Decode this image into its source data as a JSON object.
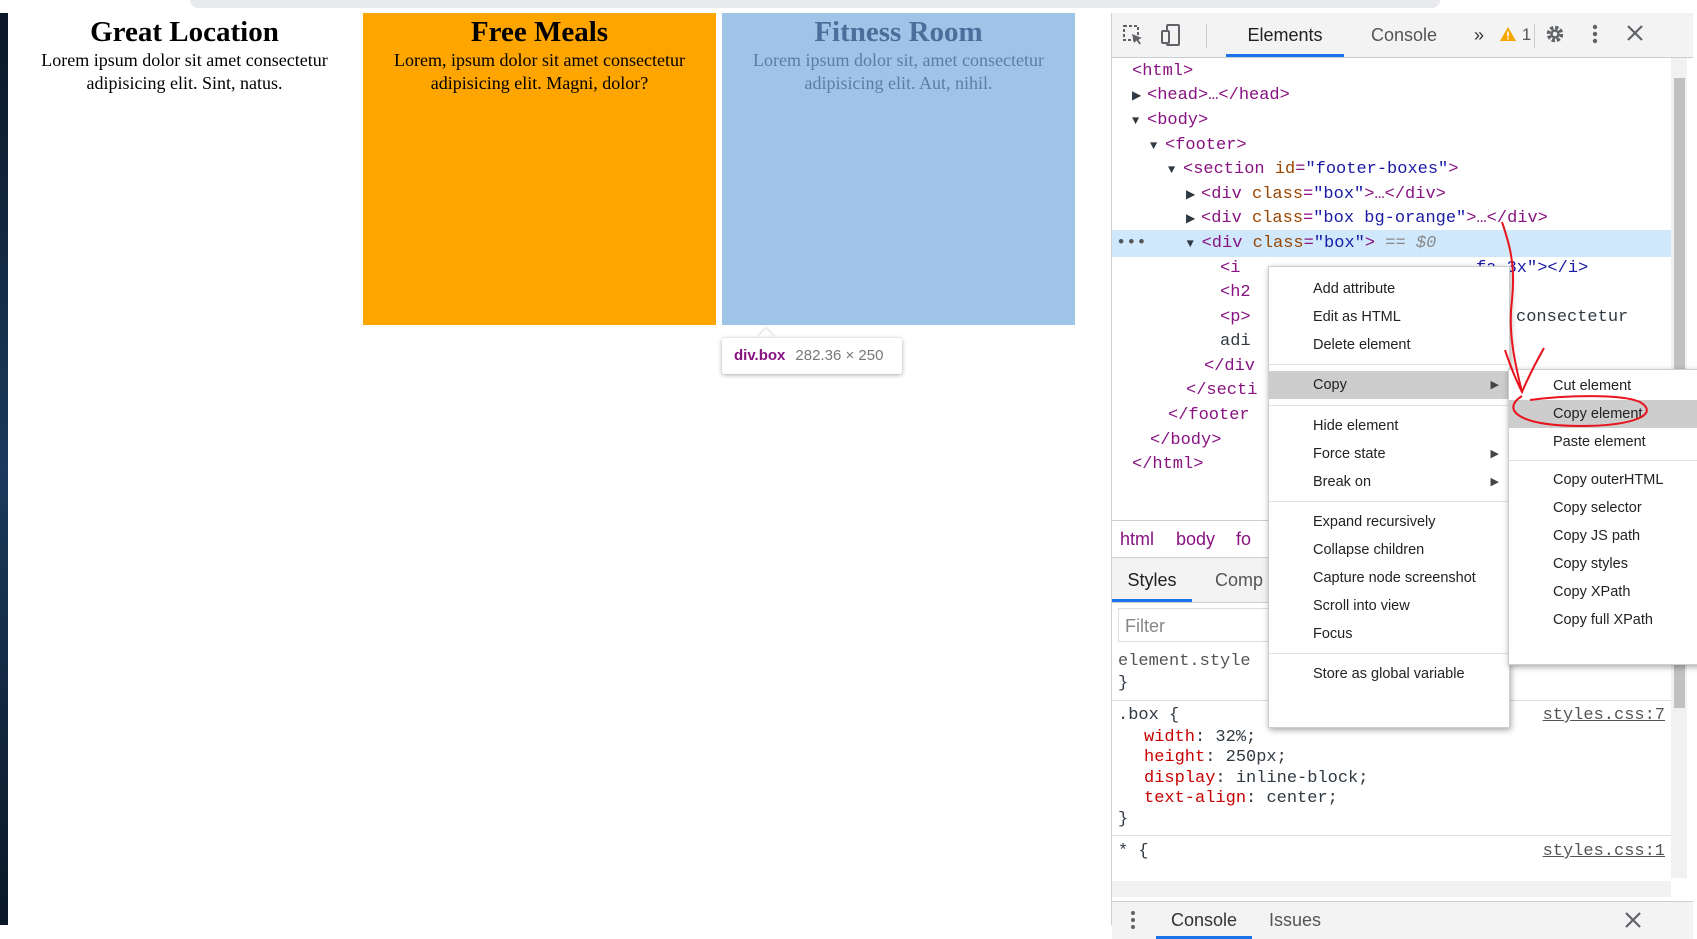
{
  "page": {
    "boxes": [
      {
        "title": "Great Location",
        "text": "Lorem ipsum dolor sit amet consectetur adipisicing elit. Sint, natus."
      },
      {
        "title": "Free Meals",
        "text": "Lorem, ipsum dolor sit amet consectetur adipisicing elit. Magni, dolor?"
      },
      {
        "title": "Fitness Room",
        "text": "Lorem ipsum dolor sit, amet consectetur adipisicing elit. Aut, nihil."
      }
    ],
    "tooltip": {
      "name": "div.box",
      "size": "282.36 × 250"
    }
  },
  "devtools": {
    "tabs": {
      "elements": "Elements",
      "console": "Console",
      "more": "»"
    },
    "warnings": "1",
    "dom": {
      "html_open": "<html>",
      "head": "<head>…</head>",
      "body_open": "<body>",
      "footer_open": "<footer>",
      "section_tag": "<section ",
      "section_attr": "id",
      "section_val": "\"footer-boxes\"",
      "div_tag": "<div ",
      "class_attr": "class",
      "box_val": "\"box\"",
      "box_orange_val": "\"box bg-orange\"",
      "collapsed_end": ">…</div>",
      "selected_suffix": "== $0",
      "i_partial": "<i",
      "i_tail": "fa-3x\"></i>",
      "h2_partial": "<h2",
      "p_partial": "<p>",
      "p_tail": "amet consectetur",
      "adi_partial": "adi",
      "div_close_partial": "</div",
      "section_close": "</secti",
      "footer_close": "</footer",
      "body_close": "</body>",
      "html_close": "</html>"
    },
    "breadcrumbs": [
      "html",
      "body",
      "fo"
    ],
    "styles_tabs": {
      "styles": "Styles",
      "computed": "Comp"
    },
    "filter_placeholder": "Filter",
    "styles": {
      "element_style": "element.style",
      "close_brace": "}",
      "box_selector": ".box {",
      "box_source": "styles.css:7",
      "props": [
        {
          "name": "width",
          "value": "32%;"
        },
        {
          "name": "height",
          "value": "250px;"
        },
        {
          "name": "display",
          "value": "inline-block;"
        },
        {
          "name": "text-align",
          "value": "center;"
        }
      ],
      "star_selector": "* {",
      "star_source": "styles.css:1"
    },
    "drawer": {
      "console": "Console",
      "issues": "Issues"
    }
  },
  "context_menu": {
    "items": [
      "Add attribute",
      "Edit as HTML",
      "Delete element",
      "Copy",
      "Hide element",
      "Force state",
      "Break on",
      "Expand recursively",
      "Collapse children",
      "Capture node screenshot",
      "Scroll into view",
      "Focus",
      "Store as global variable"
    ],
    "highlighted": "Copy"
  },
  "copy_submenu": {
    "items": [
      "Cut element",
      "Copy element",
      "Paste element",
      "Copy outerHTML",
      "Copy selector",
      "Copy JS path",
      "Copy styles",
      "Copy XPath",
      "Copy full XPath"
    ],
    "highlighted": "Copy element"
  },
  "colors": {
    "orange": "#ffa500",
    "light_blue": "#a0c4e8",
    "annotation_red": "#e8141e",
    "devtools_blue": "#1a73e8"
  }
}
